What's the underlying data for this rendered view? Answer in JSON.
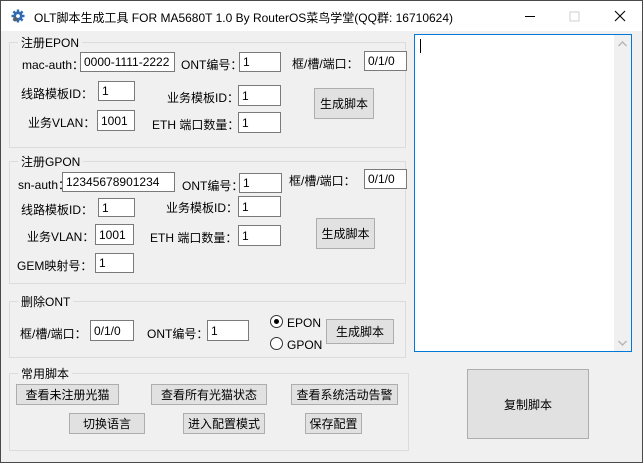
{
  "window": {
    "title": "OLT脚本生成工具 FOR MA5680T 1.0 By RouterOS菜鸟学堂(QQ群: 16710624)"
  },
  "accent_color": "#0078d7",
  "epon": {
    "title": "注册EPON",
    "mac_auth_label": "mac-auth：",
    "mac_auth_value": "0000-1111-2222",
    "ont_label": "ONT编号：",
    "ont_value": "1",
    "port_label": "框/槽/端口：",
    "port_value": "0/1/0",
    "line_profile_label": "线路模板ID：",
    "line_profile_value": "1",
    "srv_profile_label": "业务模板ID：",
    "srv_profile_value": "1",
    "vlan_label": "业务VLAN：",
    "vlan_value": "1001",
    "eth_label": "ETH 端口数量：",
    "eth_value": "1",
    "generate_label": "生成脚本"
  },
  "gpon": {
    "title": "注册GPON",
    "sn_auth_label": "sn-auth：",
    "sn_auth_value": "12345678901234",
    "ont_label": "ONT编号：",
    "ont_value": "1",
    "port_label": "框/槽/端口：",
    "port_value": "0/1/0",
    "line_profile_label": "线路模板ID：",
    "line_profile_value": "1",
    "srv_profile_label": "业务模板ID：",
    "srv_profile_value": "1",
    "vlan_label": "业务VLAN：",
    "vlan_value": "1001",
    "eth_label": "ETH 端口数量：",
    "eth_value": "1",
    "gem_label": "GEM映射号：",
    "gem_value": "1",
    "generate_label": "生成脚本"
  },
  "delete_ont": {
    "title": "删除ONT",
    "port_label": "框/槽/端口：",
    "port_value": "0/1/0",
    "ont_label": "ONT编号：",
    "ont_value": "1",
    "epon_label": "EPON",
    "gpon_label": "GPON",
    "selected_mode": "EPON",
    "generate_label": "生成脚本"
  },
  "common": {
    "title": "常用脚本",
    "view_unregistered": "查看未注册光猫",
    "view_all_status": "查看所有光猫状态",
    "view_alarms": "查看系统活动告警",
    "switch_language": "切换语言",
    "enter_config": "进入配置模式",
    "save_config": "保存配置"
  },
  "output": {
    "script_text": "",
    "copy_label": "复制脚本"
  }
}
